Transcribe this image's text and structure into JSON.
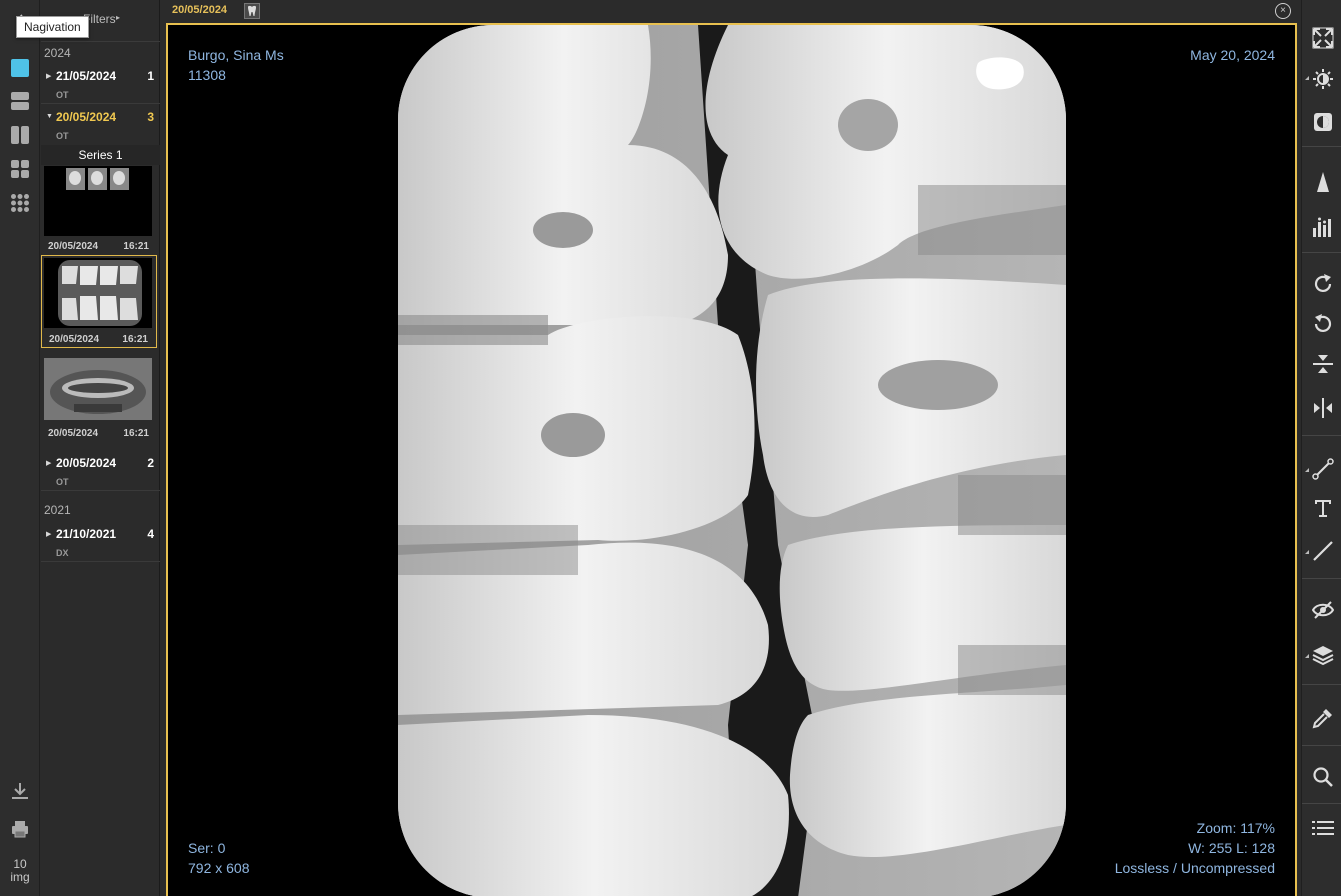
{
  "tooltip": "Nagivation",
  "filters_label": "Filters",
  "left_rail": {
    "image_count_number": "10",
    "image_count_unit": "img"
  },
  "study_list": {
    "years": [
      "2024",
      "2021"
    ],
    "studies": [
      {
        "date": "21/05/2024",
        "count": "1",
        "modality": "OT"
      },
      {
        "date": "20/05/2024",
        "count": "3",
        "modality": "OT"
      },
      {
        "date": "20/05/2024",
        "count": "2",
        "modality": "OT"
      },
      {
        "date": "21/10/2021",
        "count": "4",
        "modality": "DX"
      }
    ],
    "series_label": "Series 1",
    "thumbnails": [
      {
        "date": "20/05/2024",
        "time": "16:21"
      },
      {
        "date": "20/05/2024",
        "time": "16:21"
      },
      {
        "date": "20/05/2024",
        "time": "16:21"
      }
    ]
  },
  "viewer": {
    "header_date": "20/05/2024",
    "close_icon": "×",
    "overlay": {
      "patient_name": "Burgo, Sina Ms",
      "patient_id": "11308",
      "study_date": "May 20, 2024",
      "series": "Ser: 0",
      "dimensions": "792 x 608",
      "zoom": "Zoom: 117%",
      "window_level": "W: 255 L: 128",
      "compression": "Lossless / Uncompressed"
    }
  },
  "colors": {
    "accent": "#e8c04f",
    "overlay_text": "#8fb6e0",
    "active_layout": "#4fc3e8"
  },
  "icons": {
    "left": [
      "layout-single-icon",
      "layout-rows-icon",
      "layout-columns-icon",
      "layout-grid-2x2-icon",
      "layout-grid-3x3-icon",
      "download-icon",
      "print-icon"
    ],
    "right": [
      "fit-to-screen-icon",
      "brightness-icon",
      "invert-icon",
      "sharpen-icon",
      "histogram-icon",
      "rotate-right-icon",
      "rotate-left-icon",
      "flip-vertical-icon",
      "flip-horizontal-icon",
      "measure-icon",
      "text-annotation-icon",
      "line-icon",
      "hide-annotations-icon",
      "layers-icon",
      "eyedropper-icon",
      "zoom-icon",
      "menu-list-icon"
    ]
  }
}
